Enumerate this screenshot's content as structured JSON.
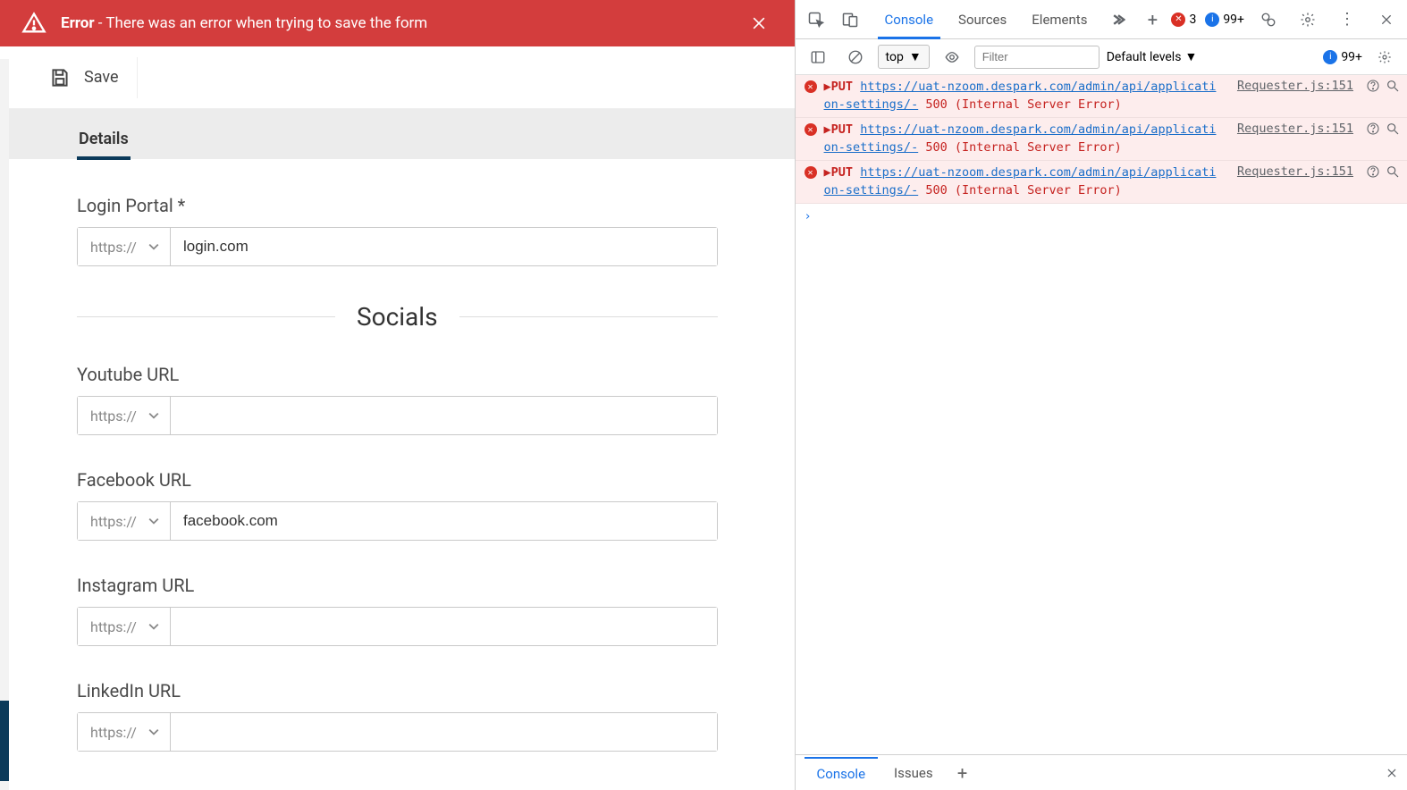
{
  "banner": {
    "title": "Error",
    "message": " - There was an error when trying to save the form"
  },
  "toolbar": {
    "save_label": "Save"
  },
  "tabs": {
    "details": "Details"
  },
  "form": {
    "protocol": "https://",
    "login_portal": {
      "label": "Login Portal *",
      "value": "login.com"
    },
    "socials_heading": "Socials",
    "youtube": {
      "label": "Youtube URL",
      "value": ""
    },
    "facebook": {
      "label": "Facebook URL",
      "value": "facebook.com"
    },
    "instagram": {
      "label": "Instagram URL",
      "value": ""
    },
    "linkedin": {
      "label": "LinkedIn URL",
      "value": ""
    }
  },
  "devtools": {
    "tabs": {
      "console": "Console",
      "sources": "Sources",
      "elements": "Elements"
    },
    "error_count": "3",
    "warn_count": "99+",
    "issues_count": "99+",
    "context": "top",
    "filter_placeholder": "Filter",
    "levels_label": "Default levels",
    "logs": [
      {
        "method": "PUT",
        "url": "https://uat-nzoom.despark.com/admin/api/application-settings/-",
        "status": "500 (Internal Server Error)",
        "source": "Requester.js:151"
      },
      {
        "method": "PUT",
        "url": "https://uat-nzoom.despark.com/admin/api/application-settings/-",
        "status": "500 (Internal Server Error)",
        "source": "Requester.js:151"
      },
      {
        "method": "PUT",
        "url": "https://uat-nzoom.despark.com/admin/api/application-settings/-",
        "status": "500 (Internal Server Error)",
        "source": "Requester.js:151"
      }
    ],
    "drawer": {
      "console": "Console",
      "issues": "Issues"
    }
  }
}
